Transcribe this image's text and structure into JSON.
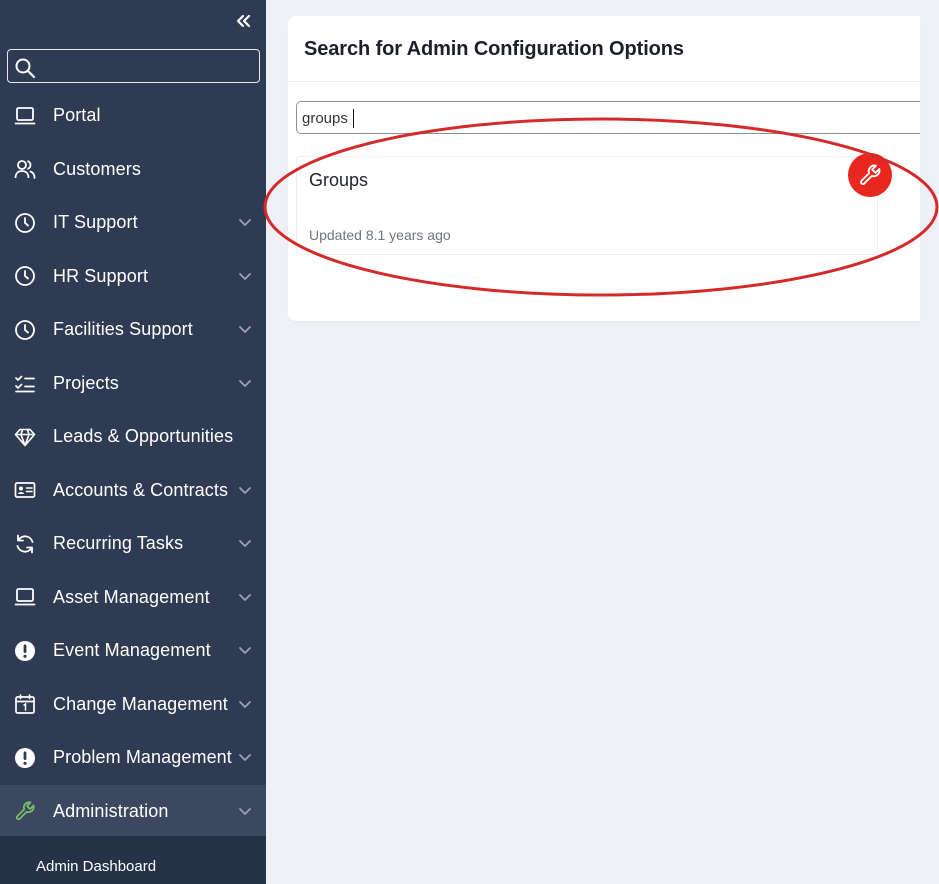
{
  "sidebar": {
    "search": {
      "value": "",
      "placeholder": ""
    },
    "items": [
      {
        "label": "Portal",
        "icon": "laptop-icon",
        "has_chevron": false
      },
      {
        "label": "Customers",
        "icon": "users-icon",
        "has_chevron": false
      },
      {
        "label": "IT Support",
        "icon": "clock-icon",
        "has_chevron": true
      },
      {
        "label": "HR Support",
        "icon": "clock-icon",
        "has_chevron": true
      },
      {
        "label": "Facilities Support",
        "icon": "clock-icon",
        "has_chevron": true
      },
      {
        "label": "Projects",
        "icon": "checklist-icon",
        "has_chevron": true
      },
      {
        "label": "Leads & Opportunities",
        "icon": "diamond-icon",
        "has_chevron": false
      },
      {
        "label": "Accounts & Contracts",
        "icon": "id-card-icon",
        "has_chevron": true
      },
      {
        "label": "Recurring Tasks",
        "icon": "refresh-icon",
        "has_chevron": true
      },
      {
        "label": "Asset Management",
        "icon": "laptop-icon",
        "has_chevron": true
      },
      {
        "label": "Event Management",
        "icon": "alert-icon",
        "has_chevron": true
      },
      {
        "label": "Change Management",
        "icon": "calendar-icon",
        "has_chevron": true
      },
      {
        "label": "Problem Management",
        "icon": "alert-icon",
        "has_chevron": true
      },
      {
        "label": "Administration",
        "icon": "wrench-icon",
        "has_chevron": true,
        "active": true
      }
    ],
    "sub_items": [
      {
        "label": "Admin Dashboard"
      }
    ]
  },
  "main": {
    "title": "Search for Admin Configuration Options",
    "search": {
      "value": "groups"
    },
    "results": [
      {
        "title": "Groups",
        "meta": "Updated 8.1 years ago",
        "icon": "wrench-icon"
      }
    ]
  },
  "colors": {
    "sidebar_bg": "#2f3b52",
    "active_bg": "#3c4860",
    "accent_red": "#e8281f",
    "annotation_red": "#d42a2a",
    "active_icon_green": "#7ec16b"
  }
}
